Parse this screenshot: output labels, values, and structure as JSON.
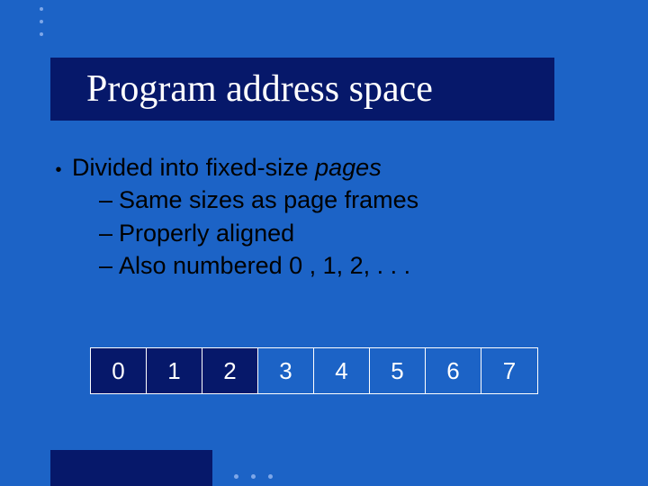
{
  "colors": {
    "bg": "#1c63c6",
    "dark": "#06186a",
    "dot": "#7ea7e8",
    "text": "#000",
    "light": "#fff"
  },
  "title": "Program address space",
  "bullets": {
    "main": {
      "prefix": "Divided into fixed-size ",
      "em": "pages"
    },
    "subs": [
      "Same sizes as page frames",
      "Properly aligned",
      "Also numbered 0 , 1,  2, . . ."
    ]
  },
  "pages": [
    "0",
    "1",
    "2",
    "3",
    "4",
    "5",
    "6",
    "7"
  ]
}
